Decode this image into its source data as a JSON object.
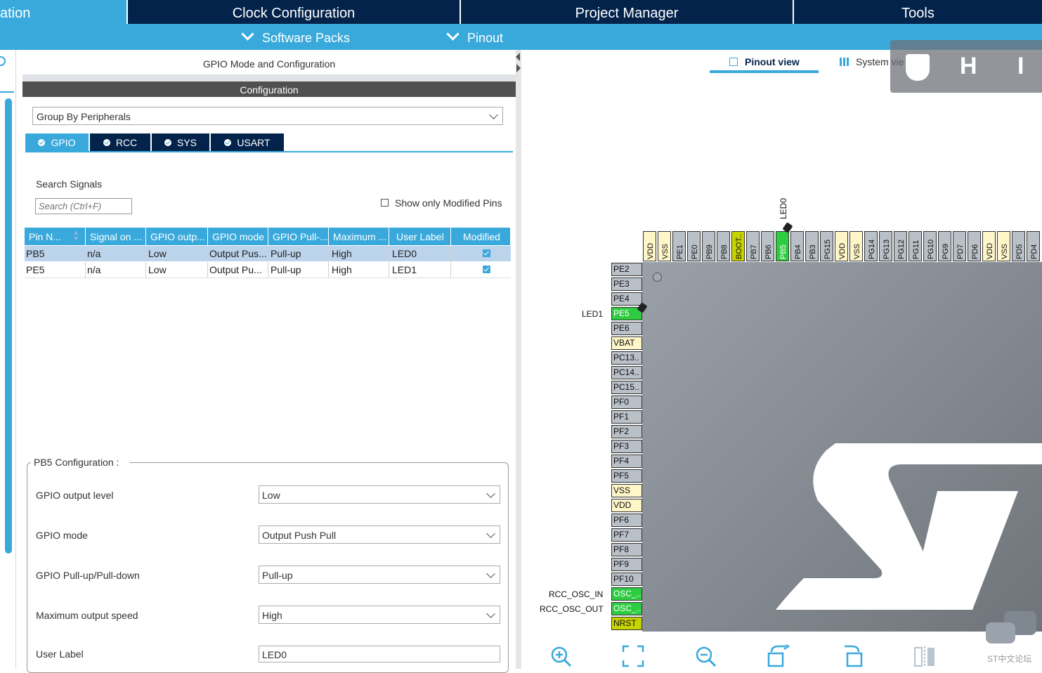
{
  "top_tabs": [
    "ation",
    "Clock Configuration",
    "Project Manager",
    "Tools"
  ],
  "sub_tabs": [
    "Software Packs",
    "Pinout"
  ],
  "panel": {
    "header": "GPIO Mode and Configuration",
    "config_bar": "Configuration",
    "group_by": "Group By Peripherals",
    "tabs": [
      "GPIO",
      "RCC",
      "SYS",
      "USART"
    ],
    "search_label": "Search Signals",
    "search_placeholder": "Search (Ctrl+F)",
    "show_modified_label": "Show only Modified Pins",
    "table": {
      "headers": [
        "Pin N...",
        "Signal on ...",
        "GPIO outp...",
        "GPIO mode",
        "GPIO Pull-...",
        "Maximum ...",
        "User Label",
        "Modified"
      ],
      "rows": [
        [
          "PB5",
          "n/a",
          "Low",
          "Output Pus...",
          "Pull-up",
          "High",
          "LED0"
        ],
        [
          "PE5",
          "n/a",
          "Low",
          "Output Pu...",
          "Pull-up",
          "High",
          "LED1"
        ]
      ]
    },
    "config_title": "PB5 Configuration :",
    "config_fields": [
      {
        "label": "GPIO output level",
        "value": "Low"
      },
      {
        "label": "GPIO mode",
        "value": "Output Push Pull"
      },
      {
        "label": "GPIO Pull-up/Pull-down",
        "value": "Pull-up"
      },
      {
        "label": "Maximum output speed",
        "value": "High"
      },
      {
        "label": "User Label",
        "value": "LED0"
      }
    ]
  },
  "right": {
    "pinout_view": "Pinout view",
    "system_view": "System vie",
    "overlay_letters": [
      "H",
      "I"
    ],
    "top_pins": [
      "VDD",
      "VSS",
      "PE1",
      "PE0",
      "PB9",
      "PB8",
      "BOOT..",
      "PB7",
      "PB6",
      "PB5",
      "PB4",
      "PB3",
      "PG15",
      "VDD",
      "VSS",
      "PG14",
      "PG13",
      "PG12",
      "PG11",
      "PG10",
      "PG9",
      "PD7",
      "PD6",
      "VDD",
      "VSS",
      "PD5",
      "PD4"
    ],
    "left_pins": [
      "PE2",
      "PE3",
      "PE4",
      "PE5",
      "PE6",
      "VBAT",
      "PC13..",
      "PC14..",
      "PC15..",
      "PF0",
      "PF1",
      "PF2",
      "PF3",
      "PF4",
      "PF5",
      "VSS",
      "VDD",
      "PF6",
      "PF7",
      "PF8",
      "PF9",
      "PF10",
      "OSC_..",
      "OSC_..",
      "NRST"
    ],
    "pin_labels": {
      "led0": "LED0",
      "led1": "LED1",
      "osc_in": "RCC_OSC_IN",
      "osc_out": "RCC_OSC_OUT"
    },
    "watermark": "ST中文论坛"
  },
  "colors": {
    "navy": "#03234b",
    "blue": "#39a9dc",
    "pin_green": "#2ecc40",
    "pin_power": "#fff6c8",
    "pin_olive": "#c8d400"
  }
}
